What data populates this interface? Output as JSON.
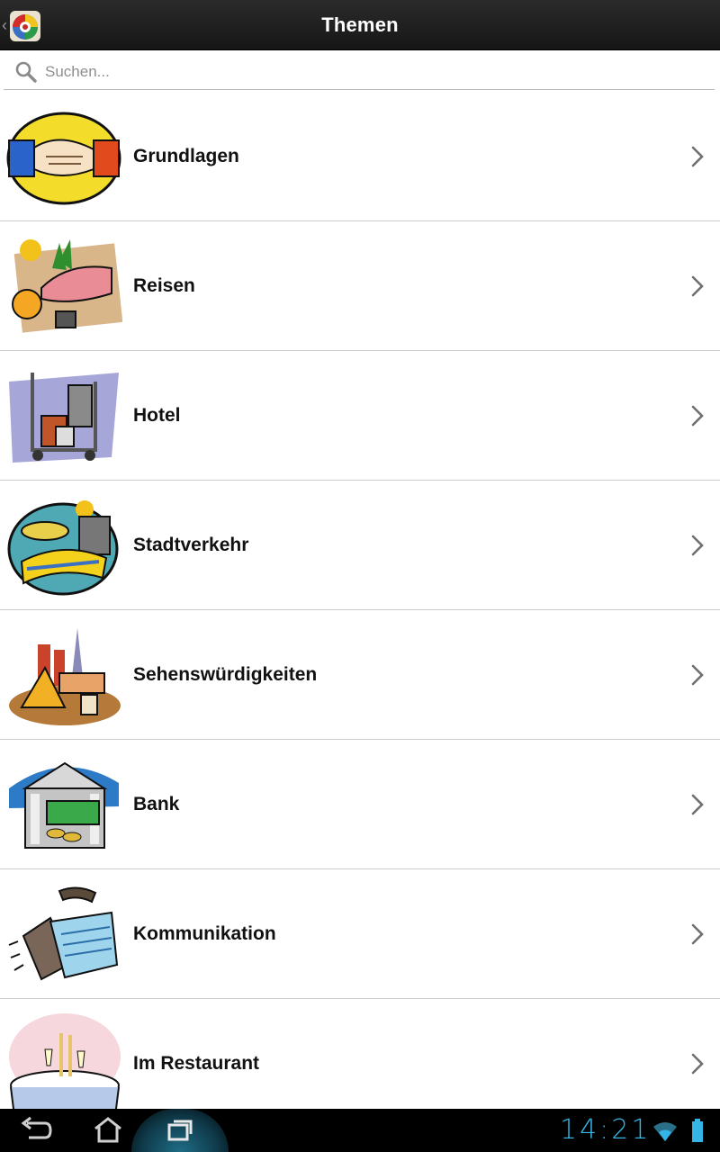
{
  "action_bar": {
    "title": "Themen",
    "up_caret": "‹",
    "app_icon": "flags-globe-icon"
  },
  "search": {
    "placeholder": "Suchen...",
    "value": "",
    "icon": "search-icon"
  },
  "topics": [
    {
      "label": "Grundlagen",
      "icon": "handshake-icon"
    },
    {
      "label": "Reisen",
      "icon": "travel-icon"
    },
    {
      "label": "Hotel",
      "icon": "luggage-cart-icon"
    },
    {
      "label": "Stadtverkehr",
      "icon": "city-traffic-icon"
    },
    {
      "label": "Sehenswürdigkeiten",
      "icon": "landmarks-icon"
    },
    {
      "label": "Bank",
      "icon": "bank-icon"
    },
    {
      "label": "Kommunikation",
      "icon": "telephone-icon"
    },
    {
      "label": "Im Restaurant",
      "icon": "restaurant-table-icon"
    }
  ],
  "status_bar": {
    "time": "14:21",
    "wifi_icon": "wifi-icon",
    "battery_icon": "battery-icon"
  },
  "nav_bar": {
    "back": "back-icon",
    "home": "home-icon",
    "recents": "recent-apps-icon"
  },
  "colors": {
    "action_bar": "#1e1e1e",
    "holo_blue": "#34b5e5",
    "divider": "#cfcfcf"
  }
}
